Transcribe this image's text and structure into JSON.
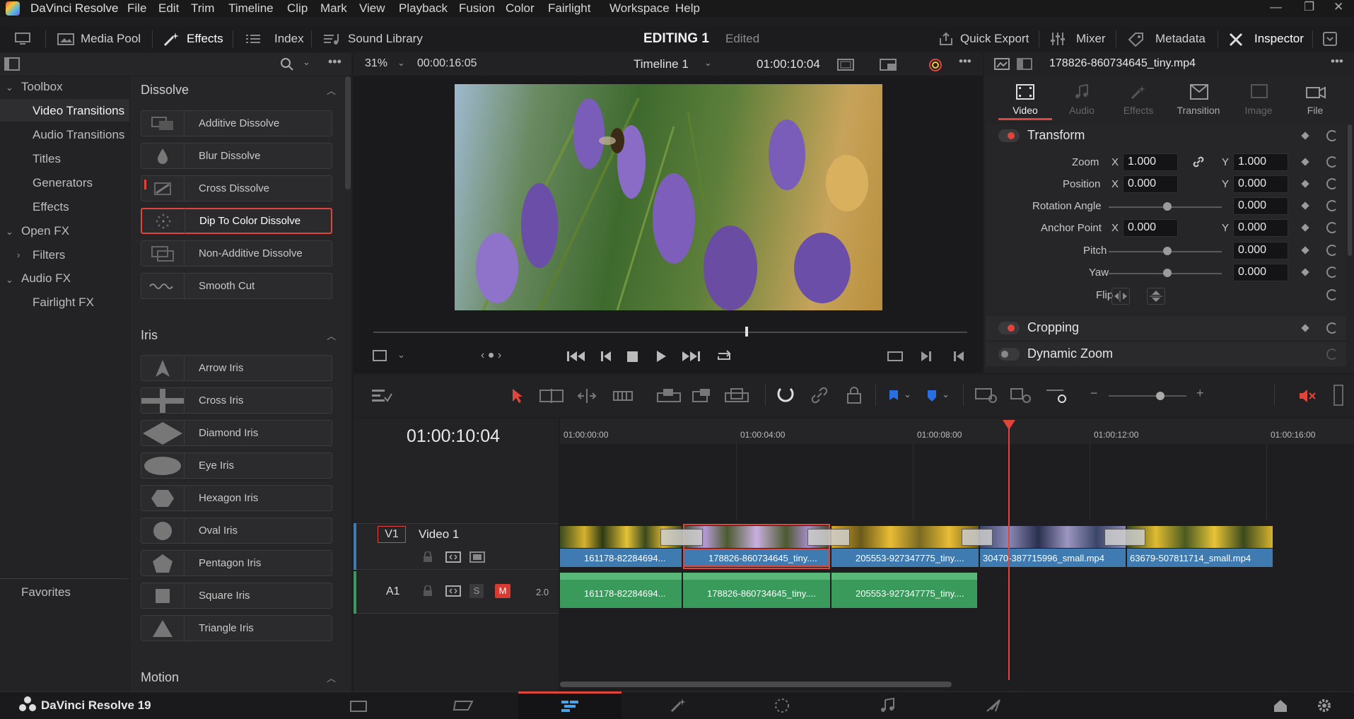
{
  "app": {
    "title": "DaVinci Resolve",
    "version_label": "DaVinci Resolve 19"
  },
  "menu": [
    "File",
    "Edit",
    "Trim",
    "Timeline",
    "Clip",
    "Mark",
    "View",
    "Playback",
    "Fusion",
    "Color",
    "Fairlight",
    "Workspace",
    "Help"
  ],
  "toolbar": {
    "media_pool": "Media Pool",
    "effects": "Effects",
    "index": "Index",
    "sound_library": "Sound Library",
    "project": "EDITING 1",
    "status": "Edited",
    "quick_export": "Quick Export",
    "mixer": "Mixer",
    "metadata": "Metadata",
    "inspector": "Inspector"
  },
  "viewer": {
    "zoom": "31%",
    "source_tc": "00:00:16:05",
    "timeline_name": "Timeline 1",
    "record_tc": "01:00:10:04"
  },
  "toolbox": {
    "items": [
      "Toolbox",
      "Video Transitions",
      "Audio Transitions",
      "Titles",
      "Generators",
      "Effects",
      "Open FX",
      "Filters",
      "Audio FX",
      "Fairlight FX"
    ],
    "favorites": "Favorites"
  },
  "effects": {
    "dissolve_title": "Dissolve",
    "dissolve": [
      "Additive Dissolve",
      "Blur Dissolve",
      "Cross Dissolve",
      "Dip To Color Dissolve",
      "Non-Additive Dissolve",
      "Smooth Cut"
    ],
    "iris_title": "Iris",
    "iris": [
      "Arrow Iris",
      "Cross Iris",
      "Diamond Iris",
      "Eye Iris",
      "Hexagon Iris",
      "Oval Iris",
      "Pentagon Iris",
      "Square Iris",
      "Triangle Iris"
    ],
    "motion_title": "Motion"
  },
  "inspector": {
    "filename": "178826-860734645_tiny.mp4",
    "tabs": [
      "Video",
      "Audio",
      "Effects",
      "Transition",
      "Image",
      "File"
    ],
    "transform": "Transform",
    "zoom_label": "Zoom",
    "zoom_x": "1.000",
    "zoom_y": "1.000",
    "position_label": "Position",
    "pos_x": "0.000",
    "pos_y": "0.000",
    "rotation_label": "Rotation Angle",
    "rotation": "0.000",
    "anchor_label": "Anchor Point",
    "anchor_x": "0.000",
    "anchor_y": "0.000",
    "pitch_label": "Pitch",
    "pitch": "0.000",
    "yaw_label": "Yaw",
    "yaw": "0.000",
    "flip_label": "Flip",
    "x": "X",
    "y": "Y",
    "cropping": "Cropping",
    "dynamic_zoom": "Dynamic Zoom"
  },
  "timeline": {
    "timecode": "01:00:10:04",
    "ruler": [
      "01:00:00:00",
      "01:00:04:00",
      "01:00:08:00",
      "01:00:12:00",
      "01:00:16:00"
    ],
    "v1_tag": "V1",
    "v1_name": "Video 1",
    "a1_tag": "A1",
    "a1_level": "2.0",
    "solo": "S",
    "mute": "M",
    "video_clips": [
      "161178-82284694...",
      "178826-860734645_tiny....",
      "205553-927347775_tiny....",
      "30470-387715996_small.mp4",
      "63679-507811714_small.mp4"
    ],
    "audio_clips": [
      "161178-82284694...",
      "178826-860734645_tiny....",
      "205553-927347775_tiny...."
    ]
  },
  "colors": {
    "accent_red": "#e0453b",
    "clip_blue": "#3f7ab0",
    "clip_green": "#3a9a5c",
    "playhead": "#e0453b"
  }
}
